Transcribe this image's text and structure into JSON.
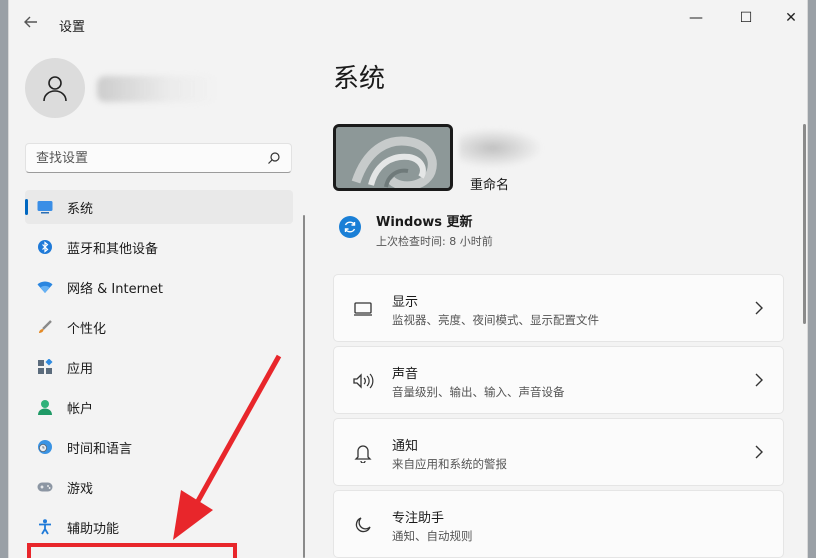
{
  "window": {
    "title": "设置",
    "back_icon": "back-arrow-icon",
    "controls": {
      "minimize": "—",
      "maximize": "☐",
      "close": "✕"
    }
  },
  "sidebar": {
    "search_placeholder": "查找设置",
    "items": [
      {
        "label": "系统",
        "icon": "monitor-icon",
        "active": true
      },
      {
        "label": "蓝牙和其他设备",
        "icon": "bluetooth-icon",
        "active": false
      },
      {
        "label": "网络 & Internet",
        "icon": "wifi-icon",
        "active": false
      },
      {
        "label": "个性化",
        "icon": "brush-icon",
        "active": false
      },
      {
        "label": "应用",
        "icon": "apps-icon",
        "active": false
      },
      {
        "label": "帐户",
        "icon": "account-icon",
        "active": false
      },
      {
        "label": "时间和语言",
        "icon": "globe-clock-icon",
        "active": false
      },
      {
        "label": "游戏",
        "icon": "gamepad-icon",
        "active": false
      },
      {
        "label": "辅助功能",
        "icon": "accessibility-icon",
        "active": false
      }
    ]
  },
  "main": {
    "title": "系统",
    "device": {
      "rename_label": "重命名"
    },
    "update": {
      "title": "Windows 更新",
      "subtitle": "上次检查时间: 8 小时前"
    },
    "cards": [
      {
        "title": "显示",
        "desc": "监视器、亮度、夜间模式、显示配置文件",
        "icon": "display-icon"
      },
      {
        "title": "声音",
        "desc": "音量级别、输出、输入、声音设备",
        "icon": "speaker-icon"
      },
      {
        "title": "通知",
        "desc": "来自应用和系统的警报",
        "icon": "bell-icon"
      },
      {
        "title": "专注助手",
        "desc": "通知、自动规则",
        "icon": "moon-icon"
      }
    ]
  },
  "colors": {
    "accent": "#0067c0",
    "annotation_red": "#e8262b"
  }
}
